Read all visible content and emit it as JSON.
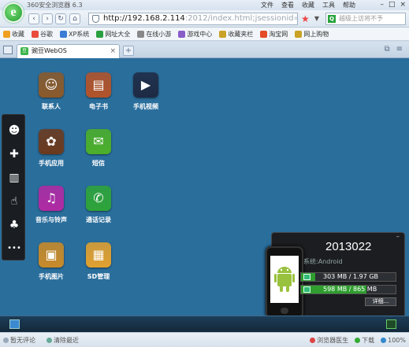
{
  "browser": {
    "title": "360安全浏览器 6.3",
    "logo_glyph": "e",
    "menus": [
      "文件",
      "查看",
      "收藏",
      "工具",
      "帮助"
    ],
    "window_buttons": [
      "–",
      "□",
      "×"
    ]
  },
  "nav": {
    "url_host": "http://192.168.2.114",
    "url_rest": ":2012/index.html;jsessionid=153xx",
    "search_placeholder": "越级上访将不予"
  },
  "bookmarks": [
    {
      "label": "收藏",
      "color": "#f0a020"
    },
    {
      "label": "谷歌",
      "color": "#e94b3c"
    },
    {
      "label": "XP系统",
      "color": "#3a7bd5"
    },
    {
      "label": "网址大全",
      "color": "#2aa040"
    },
    {
      "label": "在线小游",
      "color": "#888888"
    },
    {
      "label": "游戏中心",
      "color": "#8a5cc8"
    },
    {
      "label": "收藏夹栏",
      "color": "#c9a227"
    },
    {
      "label": "淘宝网",
      "color": "#e34c26"
    },
    {
      "label": "网上购物",
      "color": "#c9a227"
    }
  ],
  "tab": {
    "label": "豌豆WebOS",
    "favicon": "豆"
  },
  "apps": [
    {
      "label": "联系人",
      "color": "#8a5a2b",
      "glyph": "☺"
    },
    {
      "label": "电子书",
      "color": "#b2532a",
      "glyph": "▤"
    },
    {
      "label": "手机视频",
      "color": "#1e2a44",
      "glyph": "▶"
    },
    {
      "label": "手机应用",
      "color": "#6b3a1e",
      "glyph": "✿"
    },
    {
      "label": "短信",
      "color": "#4caf2a",
      "glyph": "✉"
    },
    {
      "label": "音乐与铃声",
      "color": "#b02aa4",
      "glyph": "♫"
    },
    {
      "label": "通话记录",
      "color": "#2ea43a",
      "glyph": "✆"
    },
    {
      "label": "手机图片",
      "color": "#c88a2a",
      "glyph": "▣"
    },
    {
      "label": "SD管理",
      "color": "#e0a030",
      "glyph": "▦"
    }
  ],
  "dock": [
    {
      "name": "add-contact-icon",
      "glyph": "☻"
    },
    {
      "name": "new-message-icon",
      "glyph": "✚"
    },
    {
      "name": "sd-card-icon",
      "glyph": "▥"
    },
    {
      "name": "like-icon",
      "glyph": "☝"
    },
    {
      "name": "qq-icon",
      "glyph": "♣"
    },
    {
      "name": "more-icon",
      "glyph": "•••"
    }
  ],
  "device": {
    "id": "2013022",
    "os": "系统:Android",
    "storage1": "303 MB / 1.97 GB",
    "storage1_ratio": 0.15,
    "storage2": "598 MB / 865 MB",
    "storage2_ratio": 0.69,
    "details_label": "详细...",
    "minimize": "–"
  },
  "status": {
    "left": [
      "暂无评论",
      "清除最近"
    ],
    "right": [
      "浏览器医生",
      "下载",
      "100%"
    ]
  }
}
